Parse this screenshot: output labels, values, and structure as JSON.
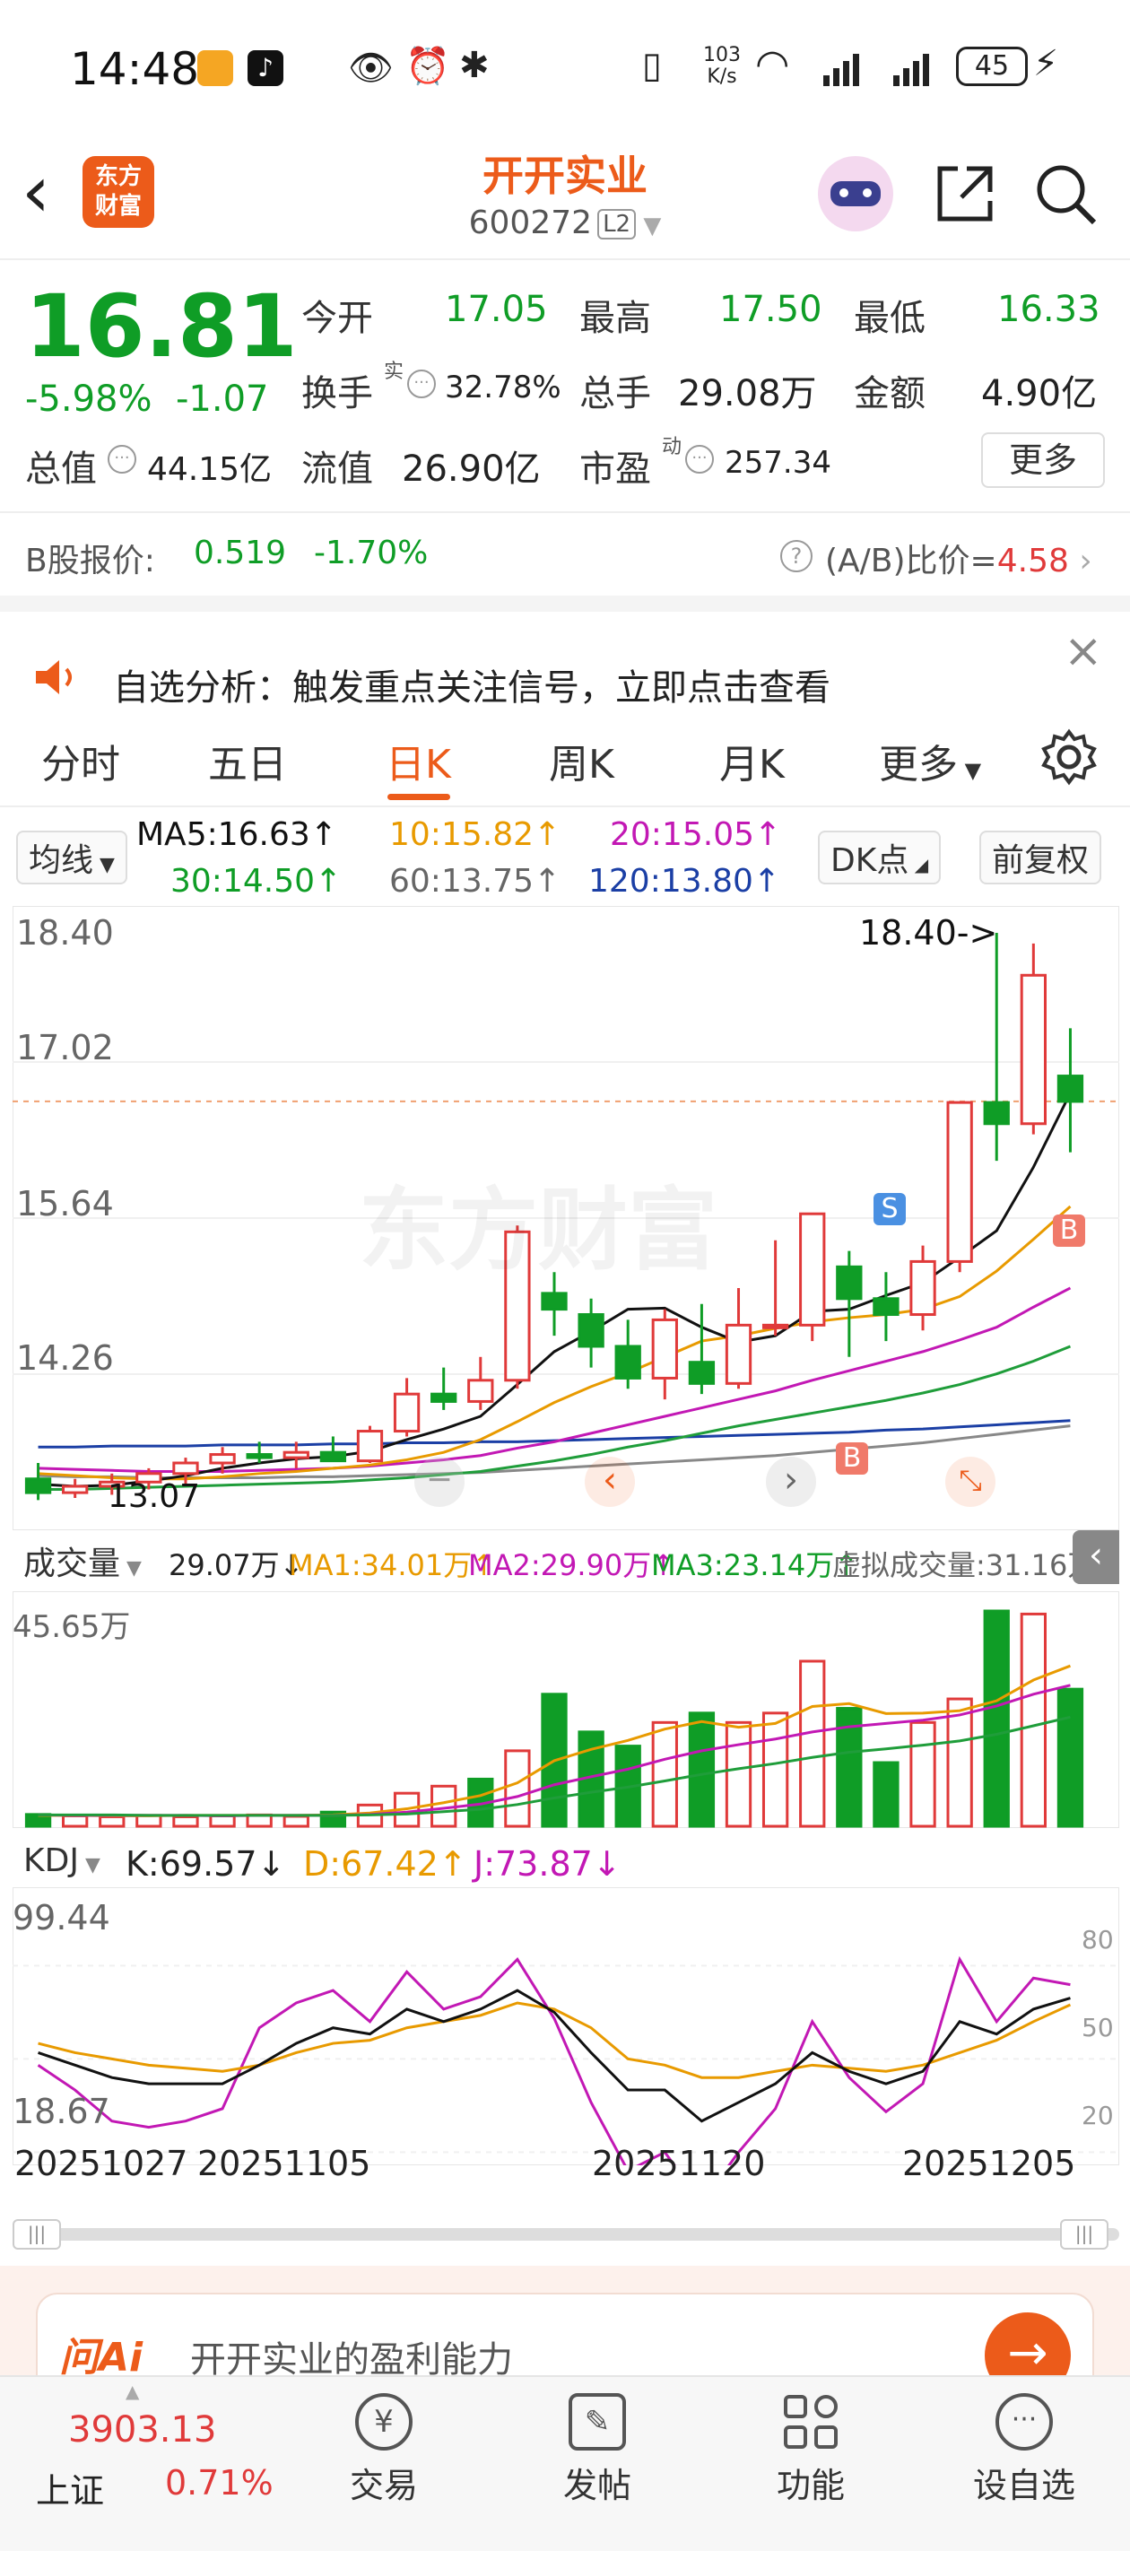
{
  "status_bar": {
    "time": "14:48",
    "net_speed_top": "103",
    "net_speed_bottom": "K/s",
    "battery": "45"
  },
  "header": {
    "brand_line1": "东方",
    "brand_line2": "财富",
    "title": "开开实业",
    "code": "600272",
    "level": "L2"
  },
  "quote": {
    "price": "16.81",
    "change_pct": "-5.98%",
    "change": "-1.07",
    "open_label": "今开",
    "open": "17.05",
    "high_label": "最高",
    "high": "17.50",
    "low_label": "最低",
    "low": "16.33",
    "turnover_label": "换手",
    "turnover_sup": "实",
    "turnover": "32.78%",
    "volume_label": "总手",
    "volume": "29.08万",
    "amount_label": "金额",
    "amount": "4.90亿",
    "mcap_label": "总值",
    "mcap": "44.15亿",
    "float_label": "流值",
    "float": "26.90亿",
    "pe_label": "市盈",
    "pe_sup": "动",
    "pe": "257.34",
    "more_label": "更多"
  },
  "bshare": {
    "label": "B股报价:",
    "price": "0.519",
    "pct": "-1.70%",
    "ratio_label": "(A/B)比价=",
    "ratio": "4.58"
  },
  "notice": {
    "text": "自选分析：触发重点关注信号，立即点击查看"
  },
  "tabs": [
    "分时",
    "五日",
    "日K",
    "周K",
    "月K",
    "更多"
  ],
  "ma": {
    "selector": "均线",
    "ma5": "MA5:16.63↑",
    "ma10": "10:15.82↑",
    "ma20": "20:15.05↑",
    "ma30": "30:14.50↑",
    "ma60": "60:13.75↑",
    "ma120": "120:13.80↑",
    "dk_label": "DK点",
    "fq_label": "前复权"
  },
  "kline": {
    "y_labels": [
      "18.40",
      "17.02",
      "15.64",
      "14.26"
    ],
    "high_marker": "18.40->",
    "low_marker": "13.07",
    "watermark": "东方财富",
    "sig_s": "S",
    "sig_b": "B"
  },
  "volume": {
    "selector": "成交量",
    "current": "29.07万↓",
    "ma1": "MA1:34.01万↑",
    "ma2": "MA2:29.90万↑",
    "ma3": "MA3:23.14万↑",
    "virtual": "虚拟成交量:31.16万",
    "max_label": "45.65万"
  },
  "kdj": {
    "selector": "KDJ",
    "k": "K:69.57↓",
    "d": "D:67.42↑",
    "j": "J:73.87↓",
    "top": "99.44",
    "bottom": "18.67",
    "r80": "80",
    "r50": "50",
    "r20": "20"
  },
  "dates": [
    "20251027",
    "20251105",
    "20251120",
    "20251205"
  ],
  "ai": {
    "logo": "问Ai",
    "prompt": "开开实业的盈利能力"
  },
  "bottom_nav": {
    "index_value": "3903.13",
    "index_name": "上证",
    "index_pct": "0.71%",
    "items": [
      "交易",
      "发帖",
      "功能",
      "设自选"
    ]
  },
  "colors": {
    "up": "#e03a3a",
    "down": "#0f9d26",
    "accent": "#ec5b1a"
  },
  "chart_data": {
    "type": "candlestick",
    "candles": [
      {
        "o": 13.25,
        "h": 13.4,
        "l": 13.05,
        "c": 13.12
      },
      {
        "o": 13.12,
        "h": 13.25,
        "l": 13.07,
        "c": 13.18
      },
      {
        "o": 13.18,
        "h": 13.3,
        "l": 13.1,
        "c": 13.22
      },
      {
        "o": 13.22,
        "h": 13.35,
        "l": 13.15,
        "c": 13.3
      },
      {
        "o": 13.3,
        "h": 13.45,
        "l": 13.2,
        "c": 13.4
      },
      {
        "o": 13.4,
        "h": 13.55,
        "l": 13.3,
        "c": 13.48
      },
      {
        "o": 13.48,
        "h": 13.6,
        "l": 13.4,
        "c": 13.45
      },
      {
        "o": 13.45,
        "h": 13.6,
        "l": 13.35,
        "c": 13.5
      },
      {
        "o": 13.5,
        "h": 13.65,
        "l": 13.42,
        "c": 13.42
      },
      {
        "o": 13.42,
        "h": 13.75,
        "l": 13.4,
        "c": 13.7
      },
      {
        "o": 13.7,
        "h": 14.2,
        "l": 13.65,
        "c": 14.05
      },
      {
        "o": 14.05,
        "h": 14.3,
        "l": 13.9,
        "c": 13.98
      },
      {
        "o": 13.98,
        "h": 14.4,
        "l": 13.9,
        "c": 14.18
      },
      {
        "o": 14.18,
        "h": 15.64,
        "l": 14.1,
        "c": 15.58
      },
      {
        "o": 15.0,
        "h": 15.2,
        "l": 14.6,
        "c": 14.85
      },
      {
        "o": 14.8,
        "h": 14.95,
        "l": 14.3,
        "c": 14.5
      },
      {
        "o": 14.5,
        "h": 14.75,
        "l": 14.1,
        "c": 14.2
      },
      {
        "o": 14.2,
        "h": 14.85,
        "l": 14.0,
        "c": 14.75
      },
      {
        "o": 14.35,
        "h": 14.9,
        "l": 14.05,
        "c": 14.15
      },
      {
        "o": 14.15,
        "h": 15.05,
        "l": 14.1,
        "c": 14.7
      },
      {
        "o": 14.7,
        "h": 15.5,
        "l": 14.6,
        "c": 14.7
      },
      {
        "o": 14.7,
        "h": 15.75,
        "l": 14.55,
        "c": 15.75
      },
      {
        "o": 15.25,
        "h": 15.4,
        "l": 14.4,
        "c": 14.95
      },
      {
        "o": 14.95,
        "h": 15.2,
        "l": 14.55,
        "c": 14.8
      },
      {
        "o": 14.8,
        "h": 15.45,
        "l": 14.65,
        "c": 15.3
      },
      {
        "o": 15.3,
        "h": 16.8,
        "l": 15.2,
        "c": 16.8
      },
      {
        "o": 16.8,
        "h": 18.4,
        "l": 16.25,
        "c": 16.6
      },
      {
        "o": 16.6,
        "h": 18.3,
        "l": 16.5,
        "c": 18.0
      },
      {
        "o": 17.05,
        "h": 17.5,
        "l": 16.33,
        "c": 16.81
      }
    ],
    "ma5": [
      13.2,
      13.18,
      13.19,
      13.23,
      13.28,
      13.35,
      13.4,
      13.44,
      13.46,
      13.51,
      13.62,
      13.72,
      13.84,
      14.14,
      14.45,
      14.64,
      14.85,
      14.86,
      14.68,
      14.54,
      14.6,
      14.83,
      14.85,
      14.98,
      15.1,
      15.34,
      15.59,
      16.19,
      16.89
    ],
    "ma10": [
      13.3,
      13.28,
      13.26,
      13.25,
      13.25,
      13.27,
      13.3,
      13.32,
      13.35,
      13.38,
      13.43,
      13.5,
      13.62,
      13.79,
      13.97,
      14.12,
      14.25,
      14.4,
      14.55,
      14.6,
      14.67,
      14.73,
      14.77,
      14.8,
      14.85,
      14.97,
      15.21,
      15.51,
      15.82
    ],
    "ma20": [
      13.35,
      13.34,
      13.33,
      13.32,
      13.32,
      13.32,
      13.33,
      13.34,
      13.35,
      13.37,
      13.4,
      13.43,
      13.47,
      13.54,
      13.6,
      13.68,
      13.76,
      13.84,
      13.92,
      14.0,
      14.08,
      14.18,
      14.27,
      14.36,
      14.45,
      14.56,
      14.68,
      14.87,
      15.05
    ],
    "ma30": [
      13.15,
      13.15,
      13.16,
      13.17,
      13.18,
      13.19,
      13.2,
      13.21,
      13.22,
      13.24,
      13.26,
      13.29,
      13.32,
      13.37,
      13.42,
      13.48,
      13.55,
      13.61,
      13.68,
      13.75,
      13.81,
      13.87,
      13.93,
      13.99,
      14.06,
      14.14,
      14.24,
      14.36,
      14.5
    ],
    "ma60": [
      13.28,
      13.27,
      13.27,
      13.26,
      13.26,
      13.26,
      13.26,
      13.27,
      13.27,
      13.28,
      13.29,
      13.3,
      13.31,
      13.33,
      13.35,
      13.37,
      13.39,
      13.41,
      13.43,
      13.45,
      13.47,
      13.5,
      13.53,
      13.56,
      13.59,
      13.63,
      13.67,
      13.71,
      13.75
    ],
    "ma120": [
      13.55,
      13.55,
      13.56,
      13.56,
      13.56,
      13.57,
      13.57,
      13.57,
      13.58,
      13.58,
      13.59,
      13.59,
      13.6,
      13.6,
      13.61,
      13.62,
      13.63,
      13.64,
      13.65,
      13.66,
      13.67,
      13.68,
      13.69,
      13.71,
      13.72,
      13.74,
      13.76,
      13.78,
      13.8
    ],
    "volume_wan": [
      2.5,
      2.2,
      2.0,
      2.3,
      2.0,
      2.2,
      2.4,
      2.1,
      3.0,
      4.5,
      7.0,
      8.5,
      10.0,
      16.0,
      28.0,
      20.0,
      17.0,
      22.0,
      24.0,
      22.0,
      24.0,
      35.0,
      25.0,
      13.5,
      22.0,
      27.0,
      45.65,
      45.0,
      29.07
    ],
    "vol_up": [
      false,
      true,
      true,
      true,
      true,
      true,
      true,
      true,
      false,
      true,
      true,
      true,
      false,
      true,
      false,
      false,
      false,
      true,
      false,
      true,
      true,
      true,
      false,
      false,
      true,
      true,
      false,
      true,
      false
    ],
    "vol_ma1": [
      2.3,
      2.3,
      2.2,
      2.2,
      2.3,
      2.3,
      2.3,
      2.3,
      2.4,
      2.8,
      3.7,
      5.0,
      6.5,
      9.2,
      13.9,
      16.3,
      18.2,
      20.6,
      22.2,
      21.0,
      21.8,
      25.4,
      26.0,
      23.9,
      24.0,
      24.5,
      26.6,
      31.0,
      34.01
    ],
    "vol_ma2": [
      2.4,
      2.3,
      2.3,
      2.3,
      2.3,
      2.2,
      2.3,
      2.3,
      2.3,
      2.5,
      3.0,
      3.8,
      4.7,
      6.3,
      8.8,
      10.5,
      12.1,
      14.2,
      16.0,
      17.3,
      18.5,
      20.0,
      21.1,
      21.8,
      22.5,
      23.6,
      25.5,
      28.0,
      29.9
    ],
    "vol_ma3": [
      2.4,
      2.4,
      2.4,
      2.3,
      2.3,
      2.3,
      2.3,
      2.3,
      2.3,
      2.4,
      2.6,
      3.1,
      3.6,
      4.6,
      6.0,
      7.2,
      8.3,
      9.6,
      11.0,
      12.2,
      13.3,
      14.6,
      15.7,
      16.4,
      17.2,
      18.1,
      19.5,
      21.3,
      23.14
    ],
    "kdj_k": [
      52,
      48,
      44,
      42,
      42,
      42,
      48,
      55,
      60,
      58,
      66,
      62,
      66,
      72,
      65,
      52,
      40,
      40,
      30,
      36,
      42,
      52,
      46,
      42,
      46,
      62,
      58,
      66,
      69.57
    ],
    "kdj_d": [
      55,
      52,
      50,
      48,
      47,
      46,
      48,
      52,
      55,
      56,
      60,
      62,
      64,
      68,
      66,
      60,
      50,
      48,
      44,
      44,
      46,
      48,
      47,
      46,
      48,
      52,
      56,
      62,
      67.42
    ],
    "kdj_j": [
      48,
      40,
      30,
      28,
      30,
      34,
      60,
      68,
      72,
      62,
      78,
      66,
      70,
      82,
      63,
      36,
      14,
      20,
      2,
      20,
      34,
      62,
      44,
      33,
      42,
      82,
      62,
      76,
      73.87
    ],
    "price_range": [
      13.07,
      18.4
    ],
    "kdj_range": [
      18.67,
      99.44
    ],
    "vol_max": 45.65
  }
}
